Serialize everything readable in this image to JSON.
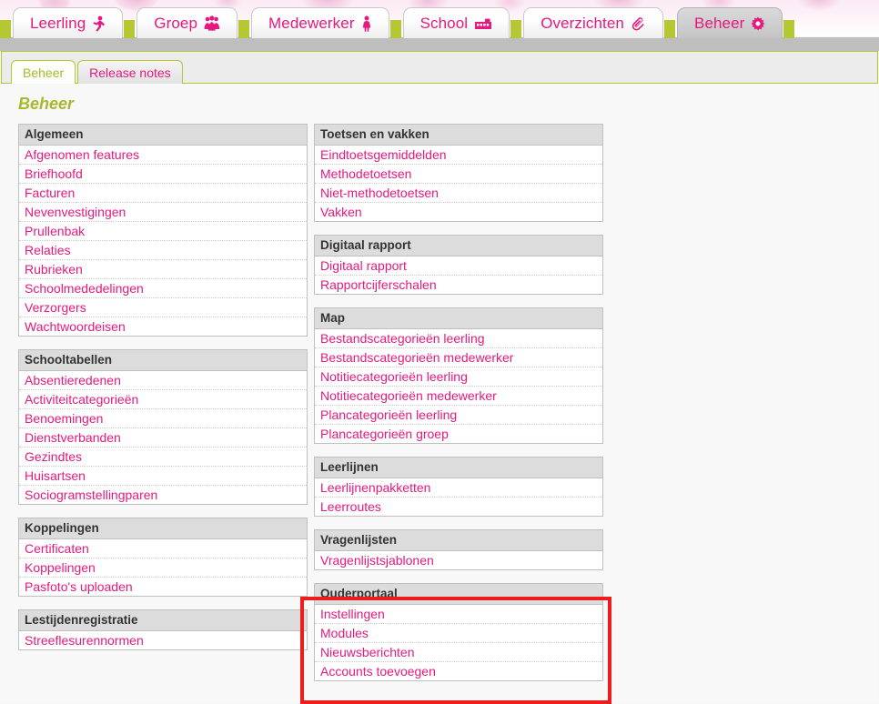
{
  "main_tabs": [
    {
      "label": "Leerling",
      "icon": "running-child-icon",
      "active": false
    },
    {
      "label": "Groep",
      "icon": "group-of-people-icon",
      "active": false
    },
    {
      "label": "Medewerker",
      "icon": "person-icon",
      "active": false
    },
    {
      "label": "School",
      "icon": "school-building-icon",
      "active": false
    },
    {
      "label": "Overzichten",
      "icon": "paperclip-icon",
      "active": false
    },
    {
      "label": "Beheer",
      "icon": "gear-icon",
      "active": true
    }
  ],
  "sub_tabs": [
    {
      "label": "Beheer",
      "active": true
    },
    {
      "label": "Release notes",
      "active": false
    }
  ],
  "page": {
    "title": "Beheer"
  },
  "colors": {
    "accent_pink": "#e5197f",
    "accent_green": "#b5c833",
    "title_olive": "#a8b92d",
    "header_gray": "#dcdcdc",
    "highlight_red": "#ee1c1c"
  },
  "columns": [
    {
      "sections": [
        {
          "title": "Algemeen",
          "items": [
            "Afgenomen features",
            "Briefhoofd",
            "Facturen",
            "Nevenvestigingen",
            "Prullenbak",
            "Relaties",
            "Rubrieken",
            "Schoolmededelingen",
            "Verzorgers",
            "Wachtwoordeisen"
          ]
        },
        {
          "title": "Schooltabellen",
          "items": [
            "Absentieredenen",
            "Activiteitcategorieën",
            "Benoemingen",
            "Dienstverbanden",
            "Gezindtes",
            "Huisartsen",
            "Sociogramstellingparen"
          ]
        },
        {
          "title": "Koppelingen",
          "items": [
            "Certificaten",
            "Koppelingen",
            "Pasfoto's uploaden"
          ]
        },
        {
          "title": "Lestijdenregistratie",
          "items": [
            "Streeflesurennormen"
          ]
        }
      ]
    },
    {
      "sections": [
        {
          "title": "Toetsen en vakken",
          "items": [
            "Eindtoetsgemiddelden",
            "Methodetoetsen",
            "Niet-methodetoetsen",
            "Vakken"
          ]
        },
        {
          "title": "Digitaal rapport",
          "items": [
            "Digitaal rapport",
            "Rapportcijferschalen"
          ]
        },
        {
          "title": "Map",
          "items": [
            "Bestandscategorieën leerling",
            "Bestandscategorieën medewerker",
            "Notitiecategorieën leerling",
            "Notitiecategorieën medewerker",
            "Plancategorieën leerling",
            "Plancategorieën groep"
          ]
        },
        {
          "title": "Leerlijnen",
          "items": [
            "Leerlijnenpakketten",
            "Leerroutes"
          ]
        },
        {
          "title": "Vragenlijsten",
          "items": [
            "Vragenlijstsjablonen"
          ]
        },
        {
          "title": "Ouderportaal",
          "highlighted": true,
          "items": [
            "Instellingen",
            "Modules",
            "Nieuwsberichten",
            "Accounts toevoegen"
          ]
        }
      ]
    }
  ]
}
